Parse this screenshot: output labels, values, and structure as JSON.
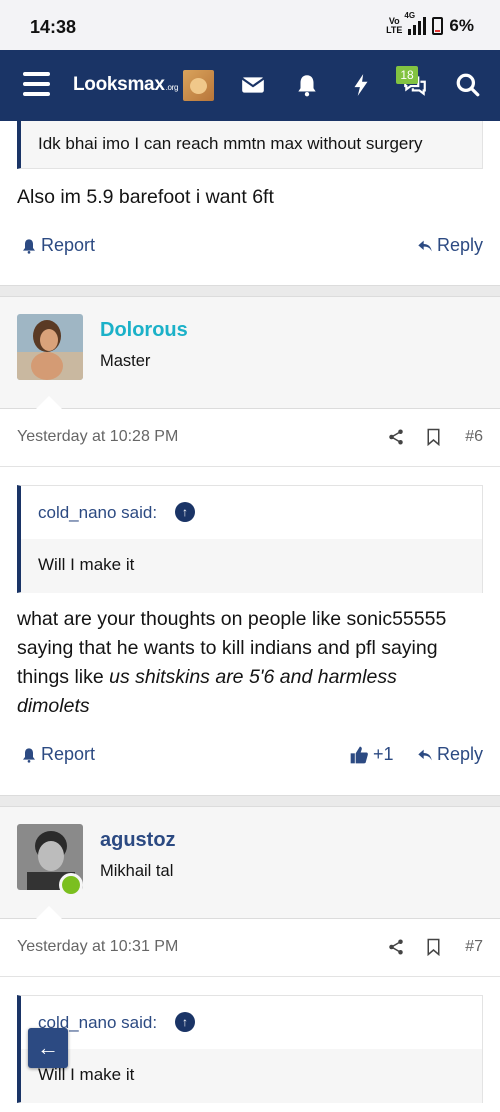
{
  "status_bar": {
    "time": "14:38",
    "network": "4G",
    "volte": "Vo LTE",
    "battery": "6%"
  },
  "navbar": {
    "logo": "Looksmax",
    "logo_suffix": ".org",
    "badge": "18"
  },
  "post_prev": {
    "quote_tail": "Idk bhai imo I can reach mmtn max without surgery",
    "text": "Also im 5.9 barefoot i want 6ft",
    "report": "Report",
    "reply": "Reply"
  },
  "post6": {
    "username": "Dolorous",
    "user_title": "Master",
    "username_color": "#1bb1c8",
    "date": "Yesterday at 10:28 PM",
    "number": "#6",
    "quote_author": "cold_nano said:",
    "quote_text": "Will I make it",
    "text_line1": "what are your thoughts on people like sonic55555",
    "text_line2": "saying that he wants to kill indians and pfl saying",
    "text_line3_plain": "things like ",
    "text_line3_italic": "us shitskins are 5'6 and harmless",
    "text_line4_italic": "dimolets",
    "report": "Report",
    "likes": "+1",
    "reply": "Reply"
  },
  "post7": {
    "username": "agustoz",
    "user_title": "Mikhail tal",
    "username_color": "#2c4a82",
    "date": "Yesterday at 10:31 PM",
    "number": "#7",
    "quote_author": "cold_nano said:",
    "quote_text": "Will I make it"
  },
  "colors": {
    "nav": "#1a3466",
    "link": "#2c4a82",
    "online": "#7bbf1f"
  },
  "icons": [
    "hamburger-icon",
    "envelope-icon",
    "bell-icon",
    "bolt-icon",
    "chat-icon",
    "search-icon",
    "share-icon",
    "bookmark-icon",
    "thumbs-up-icon",
    "reply-icon",
    "back-arrow-icon"
  ]
}
